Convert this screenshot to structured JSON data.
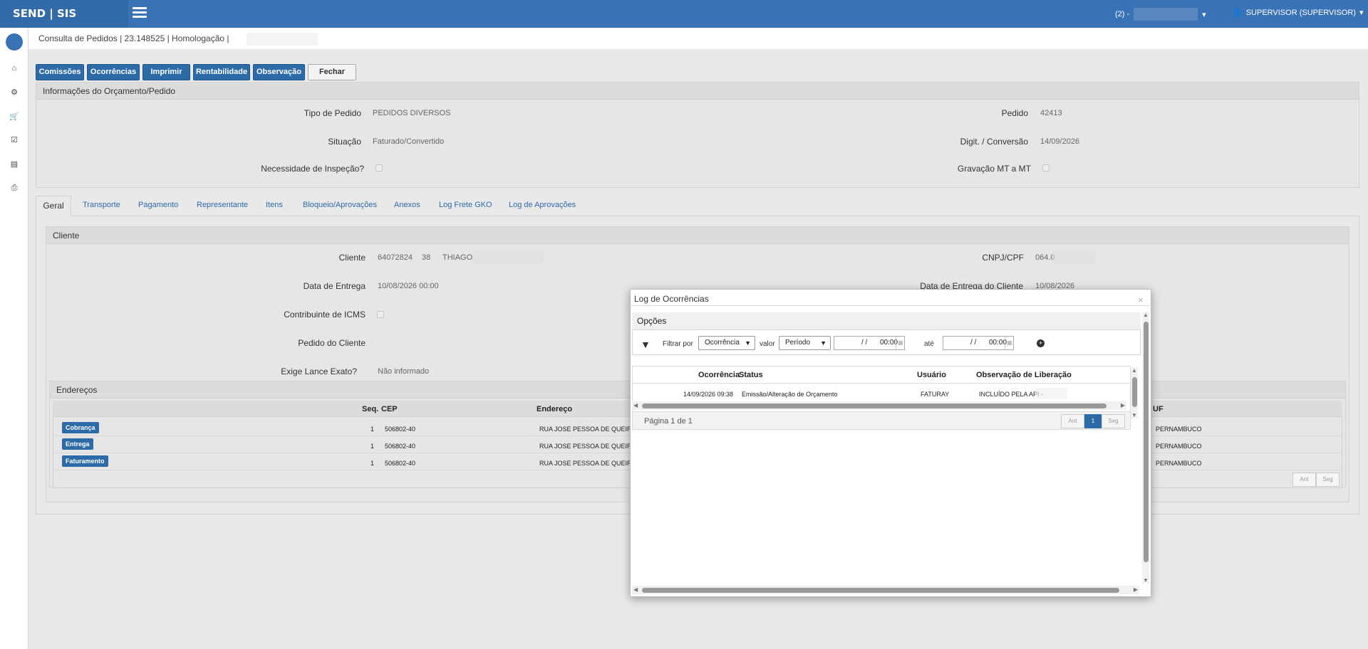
{
  "app": {
    "brand": "SEND | SIS",
    "company_prefix": "(2) -",
    "user": "SUPERVISOR (SUPERVISOR)"
  },
  "page": {
    "title": "Consulta de Pedidos | 23.148525 | Homologação |"
  },
  "toolbar": {
    "comissoes": "Comissões",
    "ocorrencias": "Ocorrências",
    "imprimir": "Imprimir",
    "rentabilidade": "Rentabilidade",
    "observacao": "Observação",
    "fechar": "Fechar"
  },
  "info": {
    "header": "Informações do Orçamento/Pedido",
    "tipo_label": "Tipo de Pedido",
    "tipo_value": "PEDIDOS DIVERSOS",
    "situacao_label": "Situação",
    "situacao_value": "Faturado/Convertido",
    "inspecao_label": "Necessidade de Inspeção?",
    "pedido_label": "Pedido",
    "pedido_value": "42413",
    "digit_label": "Digit. / Conversão",
    "digit_value": "14/09/2026",
    "gravacao_label": "Gravação MT a MT"
  },
  "tabs": [
    "Geral",
    "Transporte",
    "Pagamento",
    "Representante",
    "Itens",
    "Bloqueio/Aprovações",
    "Anexos",
    "Log Frete GKO",
    "Log de Aprovações"
  ],
  "cliente": {
    "header": "Cliente",
    "cliente_label": "Cliente",
    "cliente_code": "64072824",
    "cliente_store": "38",
    "cliente_name": "THIAGO",
    "entrega_label": "Data de Entrega",
    "entrega_value": "10/08/2026 00:00",
    "icms_label": "Contribuinte de ICMS",
    "pedido_cliente_label": "Pedido do Cliente",
    "lance_label": "Exige Lance Exato?",
    "lance_value": "Não informado",
    "cnpj_label": "CNPJ/CPF",
    "cnpj_value": "064.0",
    "entrega_cliente_label": "Data de Entrega do Cliente",
    "entrega_cliente_value": "10/08/2026"
  },
  "enderecos": {
    "header": "Endereços",
    "columns": {
      "seq": "Seq.",
      "cep": "CEP",
      "endereco": "Endereço",
      "uf": "UF"
    },
    "rows": [
      {
        "tipo": "Cobrança",
        "seq": "1",
        "cep": "506802-40",
        "endereco": "RUA JOSE PESSOA DE QUEIROZ",
        "uf": "PERNAMBUCO"
      },
      {
        "tipo": "Entrega",
        "seq": "1",
        "cep": "506802-40",
        "endereco": "RUA JOSE PESSOA DE QUEIROZ",
        "uf": "PERNAMBUCO"
      },
      {
        "tipo": "Faturamento",
        "seq": "1",
        "cep": "506802-40",
        "endereco": "RUA JOSE PESSOA DE QUEIROZ",
        "uf": "PERNAMBUCO"
      }
    ],
    "pager": {
      "prev": "Ant",
      "next": "Seg"
    }
  },
  "modal": {
    "title": "Log de Ocorrências",
    "close": "×",
    "opcoes": "Opções",
    "filtrar_por": "Filtrar por",
    "filter_field": "Ocorrência",
    "valor": "valor",
    "period": "Período",
    "date_from": "/ /",
    "time_from": "00:00",
    "ate": "até",
    "date_to": "/ /",
    "time_to": "00:00",
    "columns": {
      "ocorrencia": "Ocorrência",
      "status": "Status",
      "usuario": "Usuário",
      "obs": "Observação de Liberação"
    },
    "rows": [
      {
        "ocorrencia": "14/09/2026 09:38",
        "status": "Emissão/Alteração de Orçamento",
        "usuario": "FATURAY",
        "obs": "INCLUÍDO PELA API -"
      }
    ],
    "pager": {
      "info": "Página 1 de 1",
      "prev": "Ant",
      "page": "1",
      "next": "Seg"
    }
  }
}
